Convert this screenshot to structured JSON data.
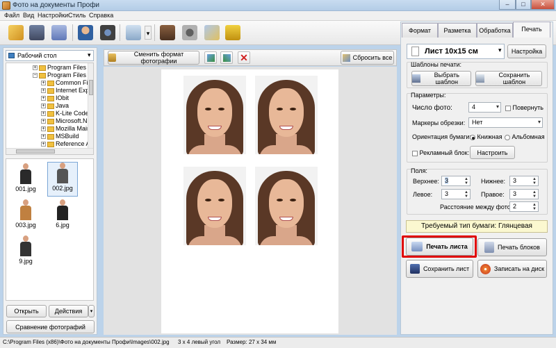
{
  "window": {
    "title": "Фото на документы Профи",
    "minimize": "–",
    "maximize": "□",
    "close": "✕"
  },
  "menu": [
    "Файл",
    "Вид",
    "Настройки",
    "Стиль",
    "Справка"
  ],
  "toolbar": {
    "icons": [
      "open-icon",
      "save-icon",
      "print-icon",
      "person-icon",
      "camera-icon",
      "image-edit-icon",
      "book-icon",
      "film-icon",
      "wand-icon",
      "cart-icon"
    ],
    "dropdown_arrow": "▾"
  },
  "left": {
    "location": "Рабочий стол",
    "tree": [
      {
        "label": "Program Files",
        "indent": 1
      },
      {
        "label": "Program Files (",
        "indent": 1
      },
      {
        "label": "Common File",
        "indent": 2
      },
      {
        "label": "Internet Exp",
        "indent": 2
      },
      {
        "label": "IObit",
        "indent": 2
      },
      {
        "label": "Java",
        "indent": 2
      },
      {
        "label": "K-Lite Codec",
        "indent": 2
      },
      {
        "label": "Microsoft.NE",
        "indent": 2
      },
      {
        "label": "Mozilla Main",
        "indent": 2
      },
      {
        "label": "MSBuild",
        "indent": 2
      },
      {
        "label": "Reference A",
        "indent": 2
      }
    ],
    "thumbnails": [
      "001.jpg",
      "002.jpg",
      "003.jpg",
      "6.jpg",
      "9.jpg"
    ],
    "open_button": "Открыть",
    "actions_button": "Действия",
    "compare_button": "Сравнение фотографий"
  },
  "center": {
    "change_format_button": "Сменить формат фотографии",
    "reset_button": "Сбросить все"
  },
  "right": {
    "tabs": [
      "Формат",
      "Разметка",
      "Обработка",
      "Печать"
    ],
    "active_tab": "Печать",
    "sheet_format": "Лист 10x15 см",
    "setup_button": "Настройка",
    "templates_label": "Шаблоны печати:",
    "choose_template": "Выбрать шаблон",
    "save_template": "Сохранить шаблон",
    "params_label": "Параметры:",
    "photo_count_label": "Число фото:",
    "photo_count": "4",
    "rotate_label": "Повернуть",
    "crop_marks_label": "Маркеры обрезки:",
    "crop_marks": "Нет",
    "orientation_label": "Ориентация бумаги:",
    "portrait": "Книжная",
    "landscape": "Альбомная",
    "ad_block_label": "Рекламный блок:",
    "ad_setup_button": "Настроить",
    "margins_label": "Поля:",
    "top_label": "Верхнее:",
    "top": "3",
    "bottom_label": "Нижнее:",
    "bottom": "3",
    "left_label": "Левое:",
    "left": "3",
    "right_label": "Правое:",
    "right": "3",
    "spacing_label": "Расстояние между фото:",
    "spacing": "2",
    "paper_type": "Требуемый тип бумаги: Глянцевая",
    "print_sheet": "Печать листа",
    "print_blocks": "Печать блоков",
    "save_sheet": "Сохранить лист",
    "burn_disk": "Записать на диск"
  },
  "status": {
    "path": "C:\\Program Files (x86)\\Фото на документы Профи\\Images\\002.jpg",
    "layout": "3 x 4 левый угол",
    "size": "Размер: 27 x 34 мм"
  },
  "colors": {
    "highlight": "#e00000",
    "paper_note_bg": "#fbf8d0",
    "window_frame": "#bcd3ea"
  }
}
